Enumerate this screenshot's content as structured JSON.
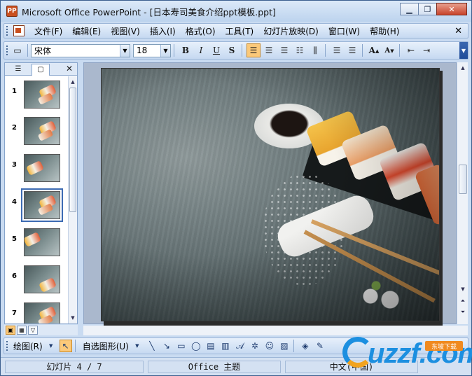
{
  "window": {
    "title": "Microsoft Office PowerPoint - [日本寿司美食介绍ppt模板.ppt]",
    "app_icon": "PP",
    "buttons": [
      "minimize",
      "maximize",
      "close"
    ]
  },
  "menu": {
    "items": [
      "文件(F)",
      "编辑(E)",
      "视图(V)",
      "插入(I)",
      "格式(O)",
      "工具(T)",
      "幻灯片放映(D)",
      "窗口(W)",
      "帮助(H)"
    ],
    "close_glyph": "✕"
  },
  "toolbar": {
    "font_name": "宋体",
    "font_size": "18",
    "bold": "B",
    "italic": "I",
    "underline": "U",
    "shadow": "S",
    "grow_font": "A",
    "shrink_font": "A"
  },
  "slides_panel": {
    "slides": [
      {
        "num": "1"
      },
      {
        "num": "2"
      },
      {
        "num": "3"
      },
      {
        "num": "4"
      },
      {
        "num": "5"
      },
      {
        "num": "6"
      },
      {
        "num": "7"
      }
    ],
    "selected_index": 4
  },
  "drawing_bar": {
    "draw_label": "绘图(R)",
    "autoshapes_label": "自选图形(U)"
  },
  "status": {
    "slide_position": "幻灯片 4 / 7",
    "theme": "Office 主题",
    "language": "中文(中国)"
  },
  "watermark": {
    "brand": "uzzf.com",
    "tag": "东坡下载"
  }
}
